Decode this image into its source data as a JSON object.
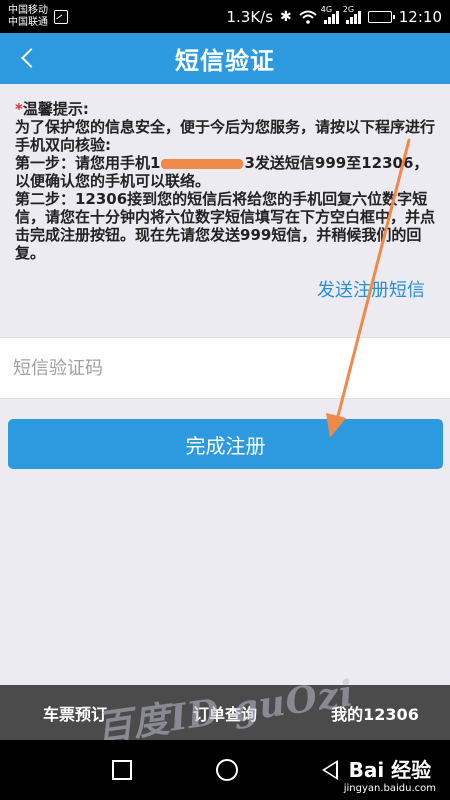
{
  "status_bar": {
    "carrier1": "中国移动",
    "carrier2": "中国联通",
    "net_speed": "1.3K/s",
    "net_tag_1": "4G",
    "net_tag_2": "2G",
    "time": "12:10",
    "icons": [
      "sim-icon",
      "bluetooth-icon",
      "wifi-icon",
      "signal-icon",
      "battery-icon"
    ]
  },
  "header": {
    "title": "短信验证",
    "back_icon": "chevron-left-icon"
  },
  "tips": {
    "star": "*",
    "heading": "温馨提示:",
    "intro": "为了保护您的信息安全，便于今后为您服务，请按以下程序进行手机双向核验:",
    "step1_a": "第一步：请您用手机1",
    "step1_b": "3发送短信999至12306，以便确认您的手机可以联络。",
    "step2": "第二步：12306接到您的短信后将给您的手机回复六位数字短信，请您在十分钟内将六位数字短信填写在下方空白框中，并点击完成注册按钮。现在先请您发送999短信，并稍候我们的回复。"
  },
  "send_link": "发送注册短信",
  "code_input": {
    "placeholder": "短信验证码",
    "value": ""
  },
  "submit_button": "完成注册",
  "tabs": [
    "车票预订",
    "订单查询",
    "我的12306"
  ],
  "watermark": "百度ID guOzi",
  "baidu_logo": {
    "main": "Bai 经验",
    "sub": "jingyan.baidu.com"
  },
  "colors": {
    "accent": "#2d9ae0",
    "link": "#2b8fd6",
    "annotation": "#f1894a",
    "required_star": "#e0322e"
  }
}
